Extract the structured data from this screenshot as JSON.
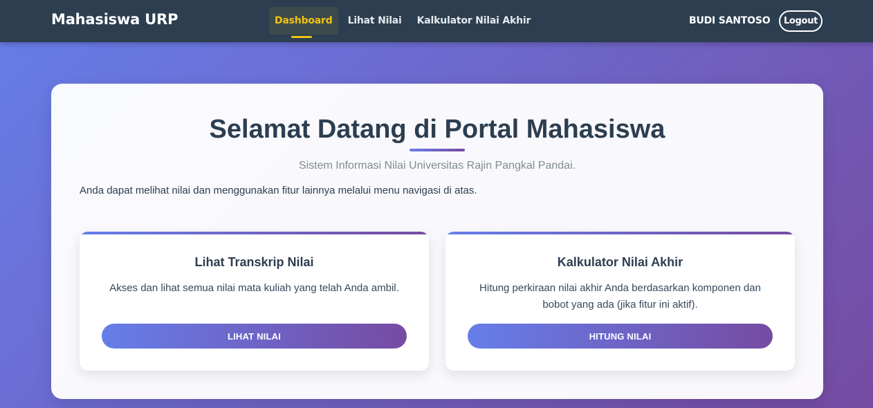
{
  "navbar": {
    "brand": "Mahasiswa URP",
    "links": [
      {
        "label": "Dashboard",
        "active": true
      },
      {
        "label": "Lihat Nilai",
        "active": false
      },
      {
        "label": "Kalkulator Nilai Akhir",
        "active": false
      }
    ],
    "username": "BUDI SANTOSO",
    "logout_label": "Logout"
  },
  "main": {
    "title": "Selamat Datang di Portal Mahasiswa",
    "subtitle": "Sistem Informasi Nilai Universitas Rajin Pangkal Pandai.",
    "intro": "Anda dapat melihat nilai dan menggunakan fitur lainnya melalui menu navigasi di atas.",
    "features": [
      {
        "title": "Lihat Transkrip Nilai",
        "description": "Akses dan lihat semua nilai mata kuliah yang telah Anda ambil.",
        "button_label": "LIHAT NILAI"
      },
      {
        "title": "Kalkulator Nilai Akhir",
        "description": "Hitung perkiraan nilai akhir Anda berdasarkan komponen dan bobot yang ada (jika fitur ini aktif).",
        "button_label": "HITUNG NILAI"
      }
    ]
  },
  "colors": {
    "navbar_bg": "#2c3e50",
    "active_accent": "#f1c40f",
    "gradient_start": "#667eea",
    "gradient_end": "#764ba2"
  }
}
